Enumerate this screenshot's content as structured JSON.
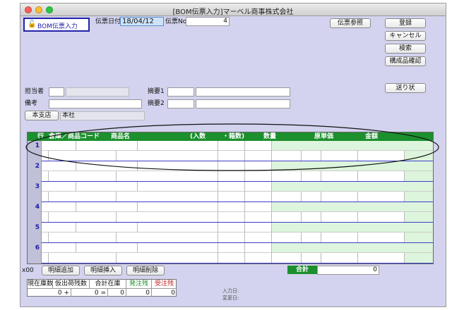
{
  "window": {
    "title": "[BOM伝票入力]マーベル商事株式会社"
  },
  "tab": {
    "icon": "lock-icon",
    "label": "BOM伝票入力"
  },
  "header": {
    "date_label": "伝票日付",
    "date_value": "18/04/12",
    "no_label": "伝票No",
    "no_value": "4"
  },
  "buttons": {
    "slip_ref": "伝票参照",
    "register": "登録",
    "cancel": "キャンセル",
    "search": "検索",
    "component_check": "構成品確認",
    "delivery": "送り状",
    "branch": "本支店"
  },
  "form": {
    "person_label": "担当者",
    "note_label": "備考",
    "summary1_label": "摘要1",
    "summary2_label": "摘要2",
    "branch_value": "本社"
  },
  "table": {
    "columns": {
      "line": "行",
      "warehouse_item": "倉庫／商品コード",
      "item_name": "商品名",
      "units": "(入数",
      "boxes": "・箱数)",
      "quantity": "数量",
      "unit_cost": "原単価",
      "amount": "金額"
    },
    "rows": [
      {
        "no": "1"
      },
      {
        "no": "2"
      },
      {
        "no": "3"
      },
      {
        "no": "4"
      },
      {
        "no": "5"
      },
      {
        "no": "6"
      }
    ]
  },
  "footer": {
    "x00": "x00",
    "add_line": "明細追加",
    "insert_line": "明細挿入",
    "delete_line": "明細削除",
    "total_label": "合計",
    "total_value": "0",
    "input_date_label": "入力日:",
    "modified_date_label": "変更日:"
  },
  "stock": {
    "headers": [
      "現在庫数",
      "仮出荷残数",
      "合計在庫",
      "発注残",
      "受注残"
    ],
    "values": [
      "0 +",
      "0 =",
      "0",
      "0",
      "0"
    ]
  },
  "colors": {
    "window_bg": "#d3d3ef",
    "header_green": "#1c8f2e",
    "accent_blue": "#2222aa"
  }
}
